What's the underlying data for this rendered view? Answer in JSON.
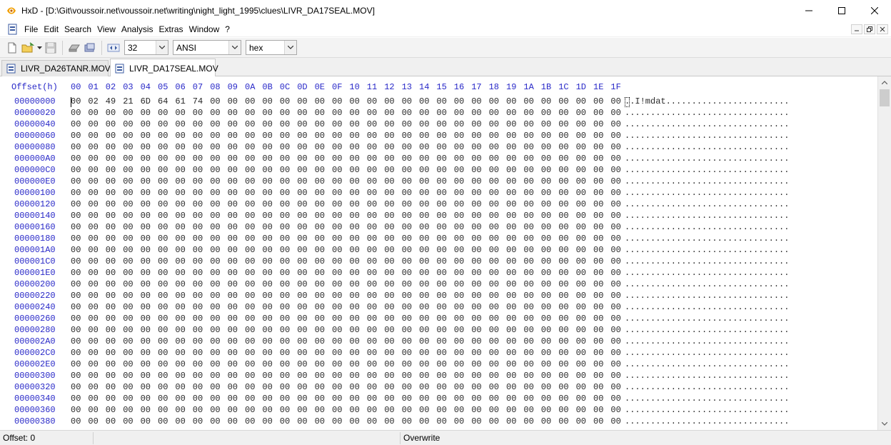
{
  "window": {
    "title": "HxD - [D:\\Git\\voussoir.net\\voussoir.net\\writing\\night_light_1995\\clues\\LIVR_DA17SEAL.MOV]"
  },
  "menu": {
    "items": [
      "File",
      "Edit",
      "Search",
      "View",
      "Analysis",
      "Extras",
      "Window",
      "?"
    ]
  },
  "toolbar": {
    "bytes_per_row": "32",
    "charset": "ANSI",
    "offset_base": "hex"
  },
  "tabs": [
    {
      "label": "LIVR_DA26TANR.MOV",
      "active": false
    },
    {
      "label": "LIVR_DA17SEAL.MOV",
      "active": true
    }
  ],
  "hex": {
    "offset_header": "Offset(h)",
    "columns": [
      "00",
      "01",
      "02",
      "03",
      "04",
      "05",
      "06",
      "07",
      "08",
      "09",
      "0A",
      "0B",
      "0C",
      "0D",
      "0E",
      "0F",
      "10",
      "11",
      "12",
      "13",
      "14",
      "15",
      "16",
      "17",
      "18",
      "19",
      "1A",
      "1B",
      "1C",
      "1D",
      "1E",
      "1F"
    ],
    "first_row_bytes": [
      "00",
      "02",
      "49",
      "21",
      "6D",
      "64",
      "61",
      "74"
    ],
    "zero_byte": "00",
    "first_row_ascii": "..I!mdat........................",
    "empty_ascii": "................................",
    "offsets": [
      "00000000",
      "00000020",
      "00000040",
      "00000060",
      "00000080",
      "000000A0",
      "000000C0",
      "000000E0",
      "00000100",
      "00000120",
      "00000140",
      "00000160",
      "00000180",
      "000001A0",
      "000001C0",
      "000001E0",
      "00000200",
      "00000220",
      "00000240",
      "00000260",
      "00000280",
      "000002A0",
      "000002C0",
      "000002E0",
      "00000300",
      "00000320",
      "00000340",
      "00000360",
      "00000380"
    ]
  },
  "status": {
    "offset": "Offset: 0",
    "mode": "Overwrite"
  }
}
